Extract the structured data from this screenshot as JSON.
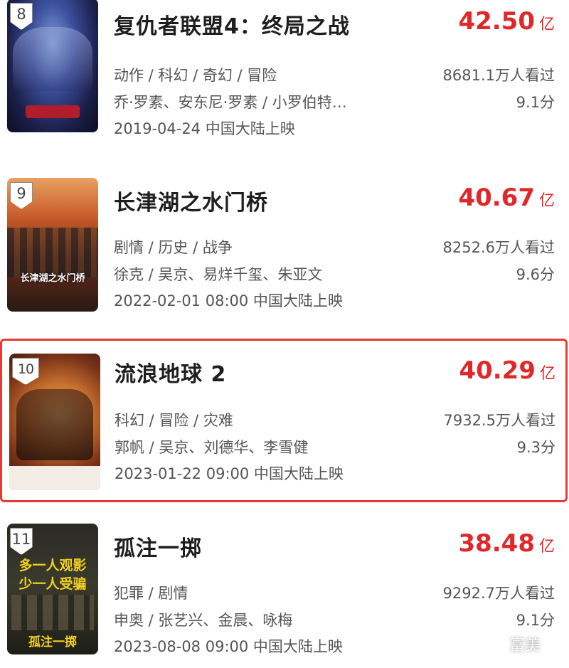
{
  "movies": [
    {
      "rank": "8",
      "title": "复仇者联盟4：终局之战",
      "box_office": "42.50",
      "box_unit": "亿",
      "genres": "动作 / 科幻 / 奇幻 / 冒险",
      "views": "8681.1万人看过",
      "cast": "乔·罗素、安东尼·罗素 / 小罗伯特…",
      "rating": "9.1分",
      "release": "2019-04-24 中国大陆上映"
    },
    {
      "rank": "9",
      "title": "长津湖之水门桥",
      "box_office": "40.67",
      "box_unit": "亿",
      "genres": "剧情 / 历史 / 战争",
      "views": "8252.6万人看过",
      "cast": "徐克 / 吴京、易烊千玺、朱亚文",
      "rating": "9.6分",
      "release": "2022-02-01 08:00 中国大陆上映",
      "poster_text": "长津湖之水门桥"
    },
    {
      "rank": "10",
      "title": "流浪地球 2",
      "box_office": "40.29",
      "box_unit": "亿",
      "genres": "科幻 / 冒险 / 灾难",
      "views": "7932.5万人看过",
      "cast": "郭帆 / 吴京、刘德华、李雪健",
      "rating": "9.3分",
      "release": "2023-01-22 09:00 中国大陆上映"
    },
    {
      "rank": "11",
      "title": "孤注一掷",
      "box_office": "38.48",
      "box_unit": "亿",
      "genres": "犯罪 / 剧情",
      "views": "9292.7万人看过",
      "cast": "申奥 / 张艺兴、金晨、咏梅",
      "rating": "9.1分",
      "release": "2023-08-08 09:00 中国大陆上映",
      "poster_text_1": "多一人观影",
      "poster_text_2": "少一人受骗",
      "poster_text_3": "孤注一掷"
    }
  ],
  "watermark": "富美",
  "colors": {
    "accent": "#e0282b",
    "highlight_border": "#e33b36"
  }
}
